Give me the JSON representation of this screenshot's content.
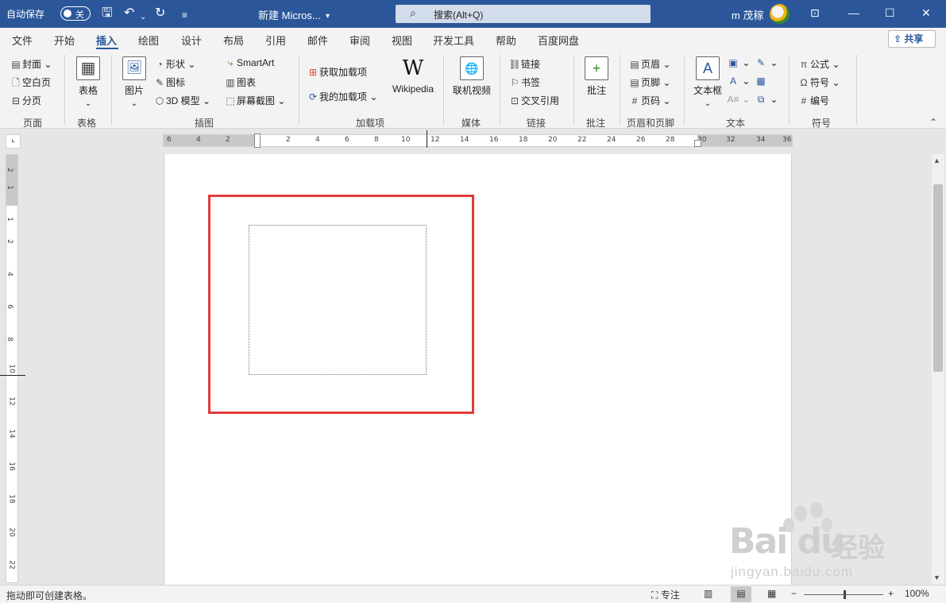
{
  "titlebar": {
    "autosave_label": "自动保存",
    "autosave_state": "关",
    "doc_title": "新建 Micros...",
    "search_placeholder": "搜索(Alt+Q)",
    "username": "m 茂稼"
  },
  "tabs": [
    "文件",
    "开始",
    "插入",
    "绘图",
    "设计",
    "布局",
    "引用",
    "邮件",
    "审阅",
    "视图",
    "开发工具",
    "帮助",
    "百度网盘"
  ],
  "active_tab": "插入",
  "share_label": "共享",
  "ribbon": {
    "page_group": {
      "label": "页面",
      "items": [
        "封面",
        "空白页",
        "分页"
      ]
    },
    "table_group": {
      "label": "表格",
      "button": "表格"
    },
    "illustrations_group": {
      "label": "插图",
      "picture": "图片",
      "items": [
        "形状",
        "图标",
        "3D 模型",
        "SmartArt",
        "图表",
        "屏幕截图"
      ]
    },
    "addins_group": {
      "label": "加载项",
      "items": [
        "获取加载项",
        "我的加载项"
      ],
      "wikipedia": "Wikipedia"
    },
    "media_group": {
      "label": "媒体",
      "button": "联机视频"
    },
    "links_group": {
      "label": "链接",
      "items": [
        "链接",
        "书签",
        "交叉引用"
      ]
    },
    "comments_group": {
      "label": "批注",
      "button": "批注"
    },
    "header_footer_group": {
      "label": "页眉和页脚",
      "items": [
        "页眉",
        "页脚",
        "页码"
      ]
    },
    "text_group": {
      "label": "文本",
      "button": "文本框"
    },
    "symbols_group": {
      "label": "符号",
      "items": [
        "公式",
        "符号",
        "编号"
      ]
    }
  },
  "hruler_numbers": [
    "6",
    "4",
    "2",
    "2",
    "4",
    "6",
    "8",
    "10",
    "12",
    "14",
    "16",
    "18",
    "20",
    "22",
    "24",
    "26",
    "28",
    "30",
    "32",
    "34",
    "36"
  ],
  "vruler_numbers": [
    "2",
    "1",
    "1",
    "2",
    "4",
    "6",
    "8",
    "10",
    "12",
    "14",
    "16",
    "18",
    "20",
    "22"
  ],
  "statusbar": {
    "message": "拖动即可创建表格。",
    "focus_label": "专注",
    "zoom": "100%",
    "zoom_minus": "−",
    "zoom_plus": "+"
  },
  "watermark": {
    "logo": "Bai du",
    "cn": "经验",
    "url": "jingyan.baidu.com"
  },
  "colors": {
    "titlebar": "#2b579a",
    "highlight_border": "#e23b3b"
  }
}
